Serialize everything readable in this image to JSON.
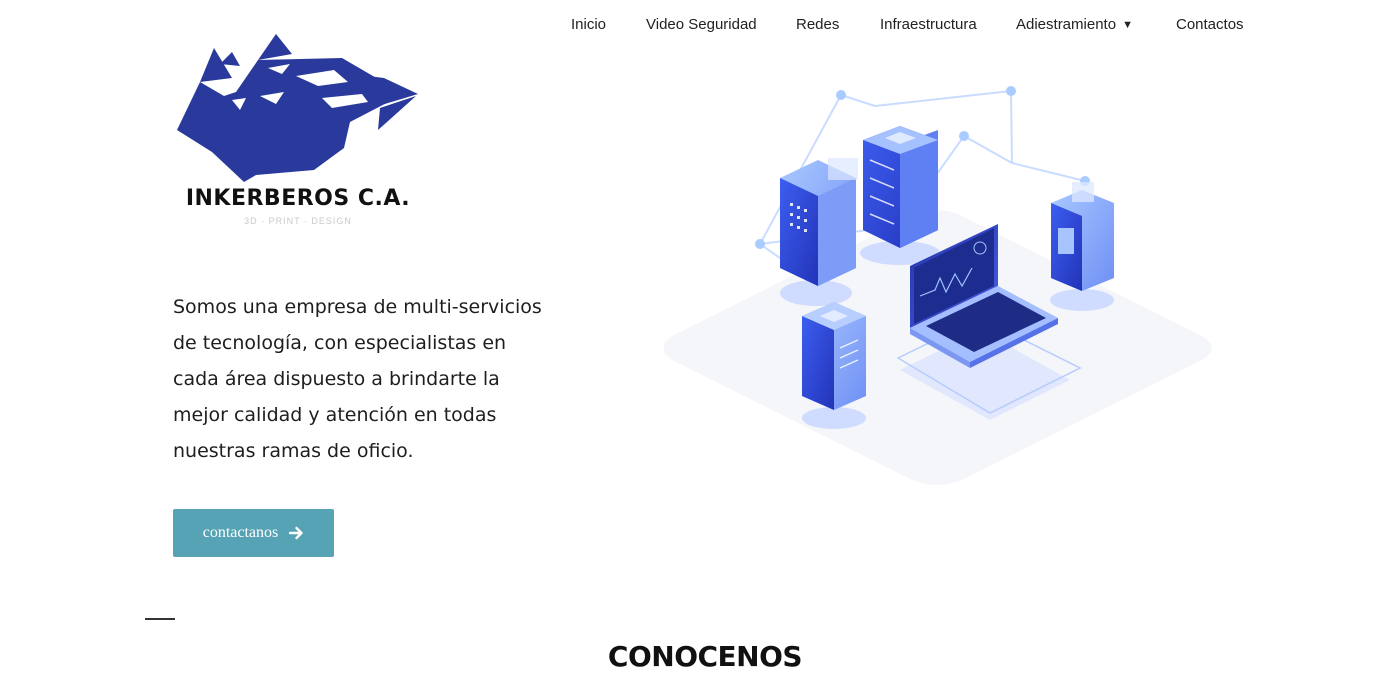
{
  "nav": {
    "items": [
      {
        "label": "Inicio"
      },
      {
        "label": "Video Seguridad"
      },
      {
        "label": "Redes"
      },
      {
        "label": "Infraestructura"
      },
      {
        "label": "Adiestramiento",
        "has_dropdown": true
      },
      {
        "label": "Contactos"
      }
    ]
  },
  "brand": {
    "name": "INKERBEROS C.A.",
    "tagline": "3D · PRINT · DESIGN",
    "logo_color": "#2a3a9c"
  },
  "hero": {
    "description": "Somos una empresa de multi-servicios de tecnología, con especialistas en cada área dispuesto a brindarte la mejor calidad y atención en todas nuestras ramas de oficio.",
    "cta_label": "contactanos",
    "cta_color": "#55a3b4",
    "illustration": "servers-network-laptop-illustration"
  },
  "section": {
    "title": "CONOCENOS"
  }
}
